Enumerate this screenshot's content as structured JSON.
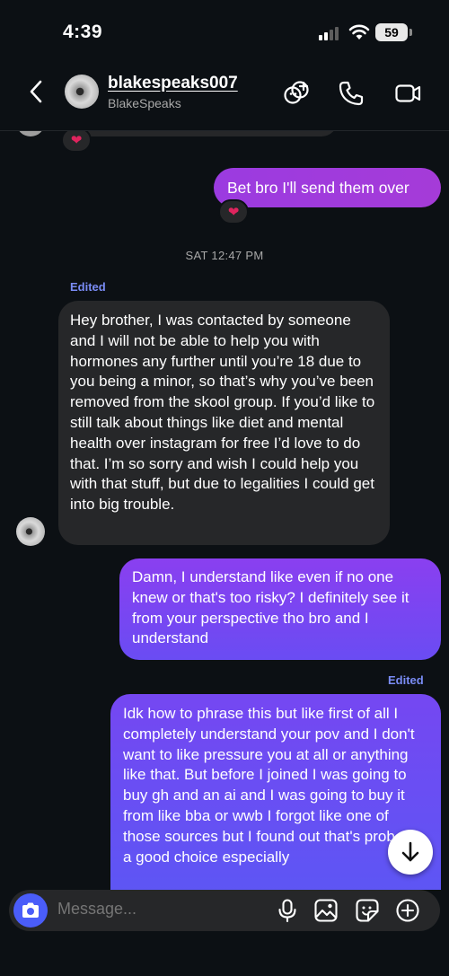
{
  "status_bar": {
    "time": "4:39",
    "battery": "59"
  },
  "header": {
    "username": "blakespeaks007",
    "display_name": "BlakeSpeaks",
    "icons": [
      "back-icon",
      "add-members-icon",
      "phone-icon",
      "video-icon"
    ]
  },
  "messages": {
    "outgoing_short": "Bet bro I'll send them over",
    "reaction": "❤",
    "timestamp": "SAT 12:47 PM",
    "edited_label": "Edited",
    "incoming": "Hey brother, I was contacted by someone and I will not be able to help you with hormones any further until you’re 18 due to you being a minor, so that’s why you’ve been removed from the skool group. If you’d like to still talk about things like diet and mental health over instagram for free I’d love to do that. I’m so sorry and wish I could help you with that stuff, but due to legalities I could get into big trouble.",
    "outgoing_1": "Damn, I understand like even if no one knew or that's too risky? I definitely see it from your perspective tho bro and I understand",
    "outgoing_2": "Idk how to phrase this but like first of all I completely understand your pov and I don't want to like pressure you at all or anything like that. But before I joined I was going to buy gh and an ai and I was going to buy it from like bba or wwb I forgot like one of those sources but I found out that's prob not a good choice especially"
  },
  "composer": {
    "placeholder": "Message...",
    "icons": [
      "camera-icon",
      "microphone-icon",
      "image-icon",
      "sticker-icon",
      "plus-icon"
    ]
  },
  "colors": {
    "background": "#0c1014",
    "incoming_bubble": "#262729",
    "outgoing_purple": "#9b3be0",
    "outgoing_violet": "#6a4cf3",
    "accent_blue": "#4a5df9",
    "edited_text": "#7a8cf5"
  }
}
